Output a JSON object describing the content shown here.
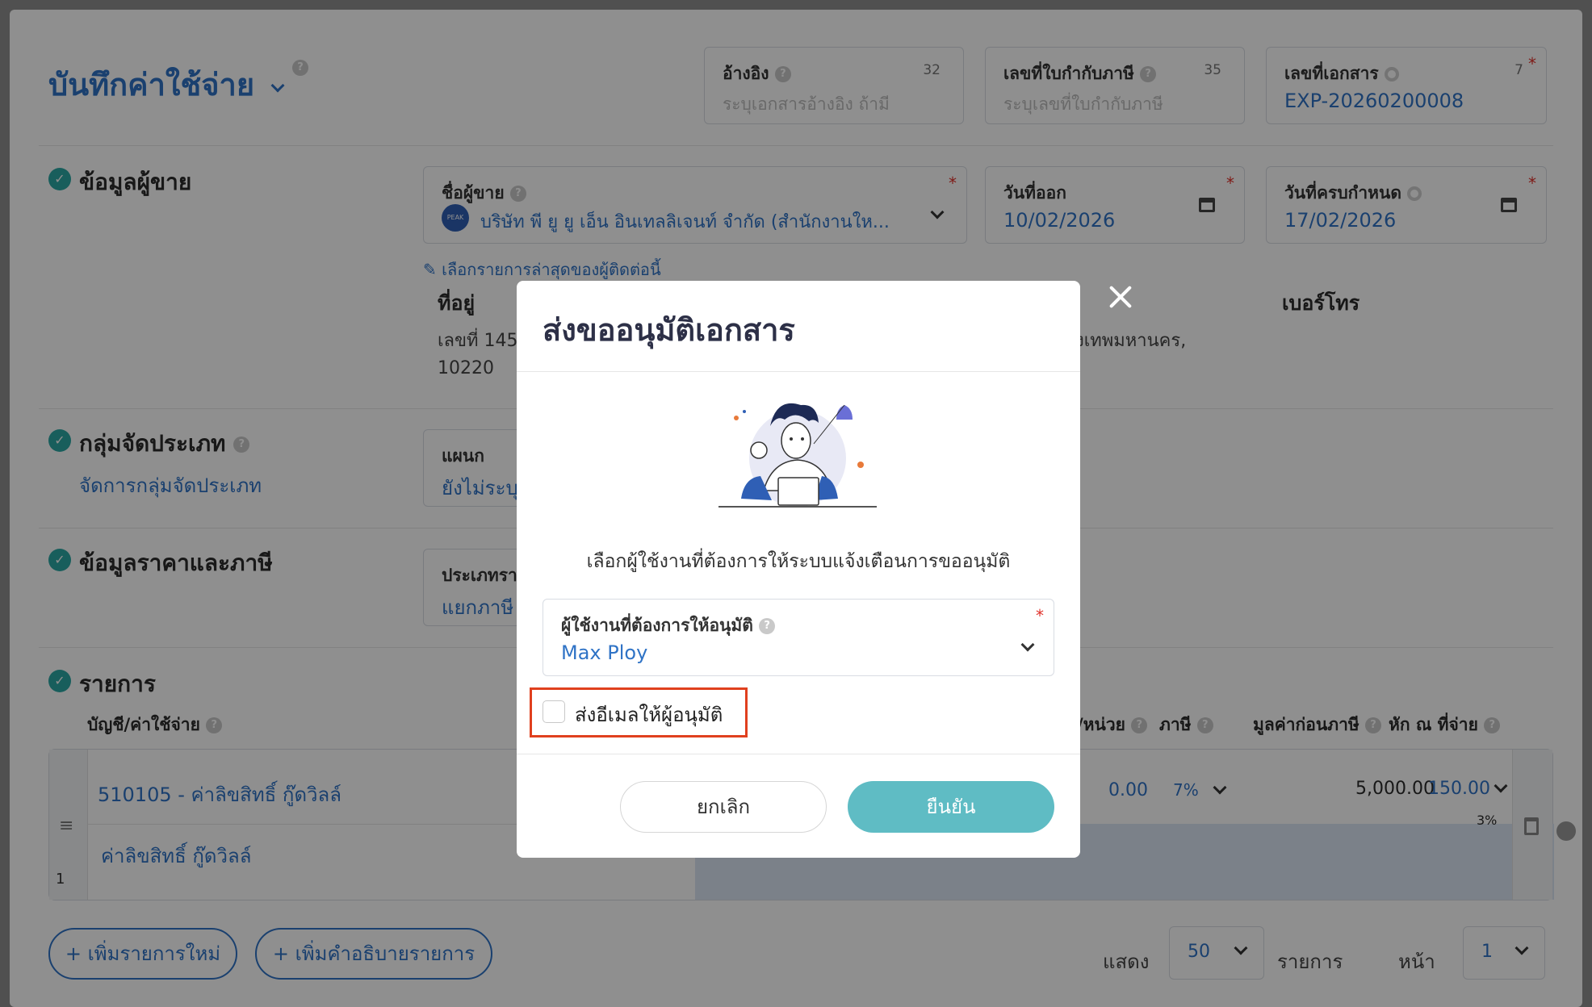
{
  "form": {
    "title": "บันทึกค่าใช้จ่าย",
    "reference": {
      "label": "อ้างอิง",
      "count": "32",
      "placeholder": "ระบุเอกสารอ้างอิง ถ้ามี"
    },
    "tax_invoice": {
      "label": "เลขที่ใบกำกับภาษี",
      "count": "35",
      "placeholder": "ระบุเลขที่ใบกำกับภาษี"
    },
    "doc_no": {
      "label": "เลขที่เอกสาร",
      "count": "7",
      "value": "EXP-20260200008"
    },
    "vendor_section": "ข้อมูลผู้ขาย",
    "vendor": {
      "label": "ชื่อผู้ขาย",
      "logo_text": "PEAK",
      "value": "บริษัท พี ยู ยู เอ็น อินเทลลิเจนท์ จำกัด (สำนักงานให..."
    },
    "issue_date": {
      "label": "วันที่ออก",
      "value": "10/02/2026"
    },
    "due_date": {
      "label": "วันที่ครบกำหนด",
      "value": "17/02/2026"
    },
    "latest_link": "เลือกรายการล่าสุดของผู้ติดต่อนี้",
    "address_label": "ที่อยู่",
    "address_line1": "เลขที่ 145",
    "address_line1_tail": "งเทพมหานคร,",
    "address_line2": "10220",
    "phone_label": "เบอร์โทร",
    "category_section": "กลุ่มจัดประเภท",
    "category_link": "จัดการกลุ่มจัดประเภท",
    "department": {
      "label": "แผนก",
      "value": "ยังไม่ระบุ"
    },
    "price_section": "ข้อมูลราคาและภาษี",
    "price_type": {
      "label": "ประเภทรา",
      "value": "แยกภาษี"
    },
    "items_section": "รายการ",
    "col_account": "บัญชี/ค่าใช้จ่าย",
    "col_unit": "/หน่วย",
    "col_tax": "ภาษี",
    "col_pretax": "มูลค่าก่อนภาษี",
    "col_wht": "หัก ณ ที่จ่าย",
    "row": {
      "number": "1",
      "account": "510105 - ค่าลิขสิทธิ์ กู๊ดวิลล์",
      "description": "ค่าลิขสิทธิ์ กู๊ดวิลล์",
      "unit_price": "0.00",
      "tax": "7%",
      "pretax": "5,000.00",
      "wht": "150.00",
      "wht_rate": "3%"
    },
    "add_item": "+ เพิ่มรายการใหม่",
    "add_desc": "+ เพิ่มคำอธิบายรายการ",
    "show_label": "แสดง",
    "show_value": "50",
    "items_label": "รายการ",
    "page_label": "หน้า",
    "page_value": "1"
  },
  "modal": {
    "title": "ส่งขออนุมัติเอกสาร",
    "prompt": "เลือกผู้ใช้งานที่ต้องการให้ระบบแจ้งเตือนการขออนุมัติ",
    "approver_label": "ผู้ใช้งานที่ต้องการให้อนุมัติ",
    "approver_value": "Max Ploy",
    "email_checkbox_label": "ส่งอีเมลให้ผู้อนุมัติ",
    "email_checked": false,
    "cancel_label": "ยกเลิก",
    "confirm_label": "ยืนยัน"
  },
  "colors": {
    "accent": "#2f73c6",
    "confirm": "#5fbcc4",
    "check": "#2ca8a4",
    "highlight": "#e0401e",
    "required": "#e0302a"
  }
}
